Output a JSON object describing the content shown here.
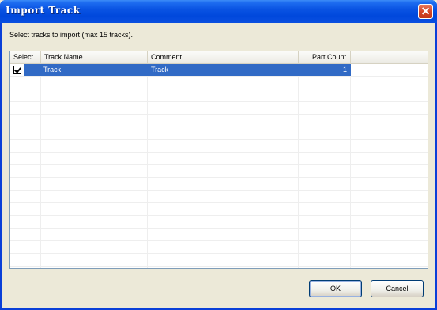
{
  "window": {
    "title": "Import Track"
  },
  "instruction": "Select tracks to import (max 15 tracks).",
  "list": {
    "columns": [
      "Select",
      "Track Name",
      "Comment",
      "Part Count"
    ],
    "rows": [
      {
        "checked": true,
        "track_name": "Track",
        "comment": "Track",
        "part_count": "1"
      }
    ]
  },
  "buttons": {
    "ok": "OK",
    "cancel": "Cancel"
  },
  "colors": {
    "selection": "#316ac5",
    "titlebar": "#0a54e3"
  }
}
